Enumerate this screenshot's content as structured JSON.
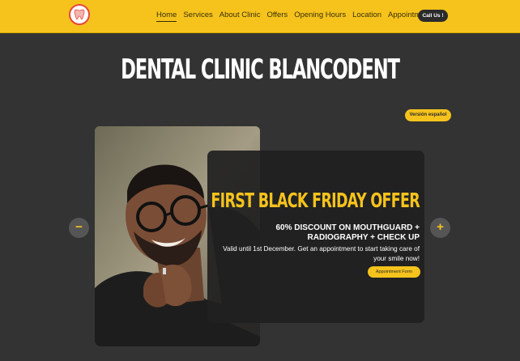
{
  "nav": {
    "items": [
      {
        "label": "Home",
        "active": true
      },
      {
        "label": "Services"
      },
      {
        "label": "About Clinic"
      },
      {
        "label": "Offers"
      },
      {
        "label": "Opening Hours"
      },
      {
        "label": "Location"
      },
      {
        "label": "Appointment"
      }
    ],
    "call_label": "Call Us !"
  },
  "hero": {
    "title": "DENTAL CLINIC BLANCODENT",
    "lang_label": "Versión español"
  },
  "offer": {
    "title": "FIRST BLACK FRIDAY OFFER",
    "subtitle_line1": "60% DISCOUNT ON MOUTHGUARD +",
    "subtitle_line2": "RADIOGRAPHY + CHECK UP",
    "desc_line1": "Valid until 1st December. Get an appointment to start taking care of",
    "desc_line2": "your smile now!",
    "button_label": "Appointment Form"
  },
  "carousel": {
    "prev_label": "−",
    "next_label": "+"
  },
  "colors": {
    "brand_yellow": "#f5c31c",
    "background": "#333333",
    "card": "#202020"
  }
}
